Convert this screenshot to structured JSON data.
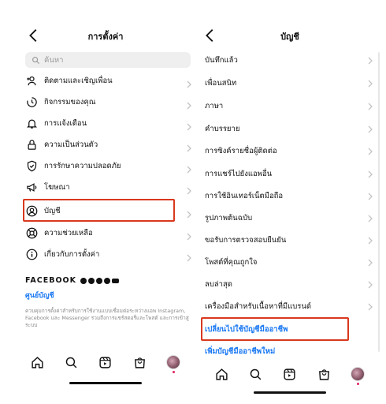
{
  "left": {
    "title": "การตั้งค่า",
    "search_placeholder": "ค้นหา",
    "items": [
      {
        "label": "ติดตามและเชิญเพื่อน",
        "icon": "add-person-icon"
      },
      {
        "label": "กิจกรรมของคุณ",
        "icon": "activity-clock-icon"
      },
      {
        "label": "การแจ้งเตือน",
        "icon": "bell-icon"
      },
      {
        "label": "ความเป็นส่วนตัว",
        "icon": "lock-icon"
      },
      {
        "label": "การรักษาความปลอดภัย",
        "icon": "shield-icon"
      },
      {
        "label": "โฆษณา",
        "icon": "megaphone-icon"
      },
      {
        "label": "บัญชี",
        "icon": "account-circle-icon"
      },
      {
        "label": "ความช่วยเหลือ",
        "icon": "lifebuoy-icon"
      },
      {
        "label": "เกี่ยวกับการตั้งค่า",
        "icon": "info-icon"
      }
    ],
    "facebook": {
      "title": "FACEBOOK",
      "link": "ศูนย์บัญชี",
      "description": "ควบคุมการตั้งค่าสำหรับการใช้งานแบบเชื่อมต่อระหว่างแอพ Instagram, Facebook และ Messenger รวมถึงการแชร์สตอรี่และโพสต์ และการเข้าสู่ระบบ"
    }
  },
  "right": {
    "title": "บัญชี",
    "items": [
      {
        "label": "บันทึกแล้ว"
      },
      {
        "label": "เพื่อนสนิท"
      },
      {
        "label": "ภาษา"
      },
      {
        "label": "คำบรรยาย"
      },
      {
        "label": "การซิงค์รายชื่อผู้ติดต่อ"
      },
      {
        "label": "การแชร์ไปยังแอพอื่น"
      },
      {
        "label": "การใช้อินเทอร์เน็ตมือถือ"
      },
      {
        "label": "รูปภาพต้นฉบับ"
      },
      {
        "label": "ขอรับการตรวจสอบยืนยัน"
      },
      {
        "label": "โพสต์ที่คุณถูกใจ"
      },
      {
        "label": "ลบล่าสุด"
      },
      {
        "label": "เครื่องมือสำหรับเนื้อหาที่มีแบรนด์"
      }
    ],
    "switch_pro": "เปลี่ยนไปใช้บัญชีมืออาชีพ",
    "add_pro": "เพิ่มบัญชีมืออาชีพใหม่"
  },
  "tabs": [
    "home-icon",
    "search-icon",
    "reels-icon",
    "shop-icon",
    "profile-avatar"
  ],
  "colors": {
    "highlight": "#d9381e",
    "link": "#1877f2"
  }
}
